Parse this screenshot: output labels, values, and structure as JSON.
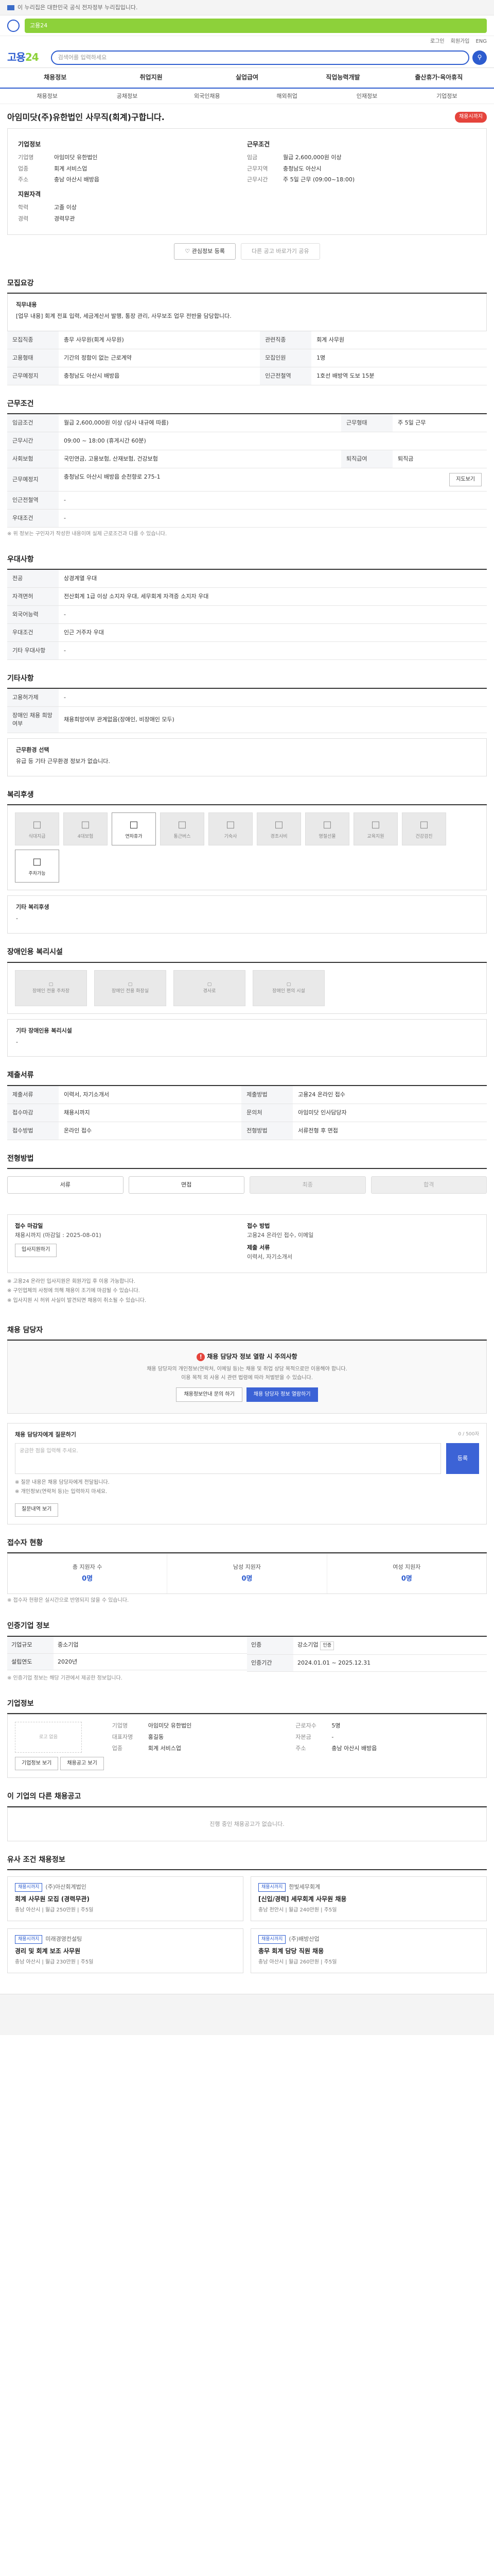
{
  "noticebar": {
    "text": "이 누리집은 대한민국 공식 전자정부 누리집입니다."
  },
  "topbar": {
    "search_text": "고용24"
  },
  "topright": {
    "links": [
      "로그인",
      "회원가입",
      "ENG"
    ]
  },
  "header": {
    "brand_a": "고용",
    "brand_b": "24",
    "search_placeholder": "검색어를 입력하세요"
  },
  "gnb": [
    "채용정보",
    "취업지원",
    "실업급여",
    "직업능력개발",
    "출산휴가·육아휴직"
  ],
  "subnav": [
    "채용정보",
    "공채정보",
    "외국인채용",
    "해외취업",
    "인재정보",
    "기업정보"
  ],
  "job": {
    "title": "아임미닷(주)유한법인 사무직(회계)구합니다.",
    "badge": "채용시까지",
    "corp_h": "기업정보",
    "corp_name_k": "기업명",
    "corp_name_v": "아임미닷 유한법인",
    "corp_field_k": "업종",
    "corp_field_v": "회계 서비스업",
    "corp_addr_k": "주소",
    "corp_addr_v": "충남 아산시 배방읍",
    "cond_h": "근무조건",
    "cond_wage_k": "임금",
    "cond_wage_v": "월급 2,600,000원 이상",
    "cond_area_k": "근무지역",
    "cond_area_v": "충청남도 아산시",
    "cond_time_k": "근무시간",
    "cond_time_v": "주 5일 근무 (09:00~18:00)",
    "req_h": "지원자격",
    "req_edu_k": "학력",
    "req_edu_v": "고졸 이상",
    "req_exp_k": "경력",
    "req_exp_v": "경력무관"
  },
  "actions": {
    "scrap": "관심정보 등록",
    "share": "다른 공고 바로가기 공유"
  },
  "sections": {
    "recruit": "모집요강",
    "work": "근무조건",
    "welfare": "복리후생",
    "welfare_facility": "장애인용 복리시설",
    "extra": "우대사항",
    "etc": "기타사항",
    "benefit": "복리후생",
    "doc": "제출서류",
    "method": "전형방법",
    "apply": "접수방법",
    "manager": "채용 담당자",
    "stats": "접수자 현황",
    "info": "인증기업 정보",
    "company": "기업정보",
    "others": "이 기업의 다른 채용공고",
    "similar": "유사 조건 채용정보"
  },
  "recruit": {
    "desc_h": "직무내용",
    "desc": "[업무 내용] 회계 전표 입력, 세금계산서 발행, 통장 관리, 사무보조 업무 전반을 담당합니다.",
    "rows": [
      {
        "k": "모집직종",
        "v": "총무 사무원(회계 사무원)"
      },
      {
        "k": "관련직종",
        "v": "회계 사무원"
      },
      {
        "k": "고용형태",
        "v": "기간의 정함이 없는 근로계약"
      },
      {
        "k": "모집인원",
        "v": "1명"
      },
      {
        "k": "근무예정지",
        "v": "충청남도 아산시 배방읍"
      },
      {
        "k": "인근전철역",
        "v": "1호선 배방역 도보 15분"
      }
    ]
  },
  "work": {
    "rows": [
      {
        "k": "임금조건",
        "v": "월급 2,600,000원 이상 (당사 내규에 따름)"
      },
      {
        "k": "근무형태",
        "v": "주 5일 근무"
      },
      {
        "k": "근무시간",
        "v": "09:00 ~ 18:00 (휴게시간 60분)"
      },
      {
        "k": "사회보험",
        "v": "국민연금, 고용보험, 산재보험, 건강보험"
      },
      {
        "k": "퇴직급여",
        "v": "퇴직금"
      },
      {
        "k": "근무예정지",
        "v": "충청남도 아산시 배방읍 순천향로 275-1"
      },
      {
        "k": "인근전철역",
        "v": "-"
      },
      {
        "k": "우대조건",
        "v": "-"
      }
    ],
    "note": "※ 위 정보는 구인자가 작성한 내용이며 실제 근로조건과 다를 수 있습니다."
  },
  "extra": {
    "rows": [
      {
        "k": "전공",
        "v": "상경계열 우대"
      },
      {
        "k": "자격면허",
        "v": "전산회계 1급 이상 소지자 우대, 세무회계 자격증 소지자 우대"
      },
      {
        "k": "외국어능력",
        "v": "-"
      },
      {
        "k": "우대조건",
        "v": "인근 거주자 우대"
      },
      {
        "k": "기타 우대사항",
        "v": "-"
      }
    ]
  },
  "etc": {
    "rows": [
      {
        "k": "고용허가제",
        "v": "-"
      },
      {
        "k": "장애인 채용 희망여부",
        "v": "채용희망여부 관계없음(장애인, 비장애인 모두)"
      }
    ],
    "subh": "근무환경 선택",
    "subv": "유급 등 기타 근무환경 정보가 없습니다."
  },
  "welfare": {
    "icons": [
      "식대지급",
      "4대보험",
      "연차휴가",
      "통근버스",
      "기숙사",
      "경조사비",
      "명절선물",
      "교육지원",
      "건강검진",
      "주차가능"
    ],
    "on": [
      2,
      9
    ],
    "etc_h": "기타 복리후생",
    "etc_v": "-"
  },
  "facility": {
    "icons": [
      "장애인 전용 주차장",
      "장애인 전용 화장실",
      "경사로",
      "장애인 편의 시설"
    ],
    "etc_h": "기타 장애인용 복리시설",
    "etc_v": "-"
  },
  "doc": {
    "rows": [
      {
        "k": "제출서류",
        "v": "이력서, 자기소개서"
      },
      {
        "k": "제출방법",
        "v": "고용24 온라인 접수"
      },
      {
        "k": "접수마감",
        "v": "채용시까지"
      },
      {
        "k": "문의처",
        "v": "아임미닷 인사담당자"
      },
      {
        "k": "접수방법",
        "v": "온라인 접수"
      },
      {
        "k": "전형방법",
        "v": "서류전형 후 면접"
      }
    ]
  },
  "method": {
    "steps": [
      "서류",
      "면접",
      "최종",
      "합격"
    ],
    "off": [
      2,
      3
    ]
  },
  "apply": {
    "l1": "접수 마감일",
    "v1": "채용시까지 (마감일 : 2025-08-01)",
    "l2": "접수 방법",
    "v2": "고용24 온라인 접수, 이메일",
    "l3": "제출 서류",
    "v3": "이력서, 자기소개서",
    "btn": "입사지원하기",
    "bul": [
      "※ 고용24 온라인 입사지원은 회원가입 후 이용 가능합니다.",
      "※ 구인업체의 사정에 의해 채용이 조기에 마감될 수 있습니다.",
      "※ 입사지원 시 허위 사실이 발견되면 채용이 취소될 수 있습니다."
    ]
  },
  "manager": {
    "warn": "채용 담당자 정보 열람 시 주의사항",
    "d1": "채용 담당자의 개인정보(연락처, 이메일 등)는 채용 및 취업 상담 목적으로만 이용해야 합니다.",
    "d2": "이용 목적 외 사용 시 관련 법령에 따라 처벌받을 수 있습니다.",
    "b1": "채용정보안내 문의 하기",
    "b2": "채용 담당자 정보 열람하기"
  },
  "qa": {
    "h": "채용 담당자에게 질문하기",
    "count": "0 / 500자",
    "placeholder": "궁금한 점을 입력해 주세요.",
    "go": "등록",
    "bul": [
      "※ 질문 내용은 채용 담당자에게 전달됩니다.",
      "※ 개인정보(연락처 등)는 입력하지 마세요."
    ],
    "more": "질문내역 보기"
  },
  "stats": [
    {
      "l": "총 지원자 수",
      "v": "0명"
    },
    {
      "l": "남성 지원자",
      "v": "0명"
    },
    {
      "l": "여성 지원자",
      "v": "0명"
    }
  ],
  "stats_note": "※ 접수자 현황은 실시간으로 반영되지 않을 수 있습니다.",
  "info": {
    "left": [
      {
        "k": "기업규모",
        "v": "중소기업"
      },
      {
        "k": "설립연도",
        "v": "2020년"
      }
    ],
    "right": [
      {
        "k": "인증",
        "v": "강소기업",
        "tag": "인증"
      },
      {
        "k": "인증기간",
        "v": "2024.01.01 ~ 2025.12.31"
      }
    ],
    "note": "※ 인증기업 정보는 해당 기관에서 제공한 정보입니다."
  },
  "company": {
    "logo": "로고 없음",
    "c1": [
      {
        "k": "기업명",
        "v": "아임미닷 유한법인"
      },
      {
        "k": "대표자명",
        "v": "홍길동"
      },
      {
        "k": "업종",
        "v": "회계 서비스업"
      }
    ],
    "c2": [
      {
        "k": "근로자수",
        "v": "5명"
      },
      {
        "k": "자본금",
        "v": "-"
      },
      {
        "k": "주소",
        "v": "충남 아산시 배방읍"
      }
    ],
    "btn1": "기업정보 보기",
    "btn2": "채용공고 보기"
  },
  "others_empty": "진행 중인 채용공고가 없습니다.",
  "similar": [
    {
      "badge": "채용시까지",
      "corp": "(주)아산회계법인",
      "title": "회계 사무원 모집 (경력무관)",
      "meta": "충남 아산시 | 월급 250만원 | 주5일"
    },
    {
      "badge": "채용시까지",
      "corp": "한빛세무회계",
      "title": "[신입/경력] 세무회계 사무원 채용",
      "meta": "충남 천안시 | 월급 240만원 | 주5일"
    },
    {
      "badge": "채용시까지",
      "corp": "미래경영컨설팅",
      "title": "경리 및 회계 보조 사무원",
      "meta": "충남 아산시 | 월급 230만원 | 주5일"
    },
    {
      "badge": "채용시까지",
      "corp": "(주)배방산업",
      "title": "총무 회계 담당 직원 채용",
      "meta": "충남 아산시 | 월급 260만원 | 주5일"
    }
  ],
  "colors": {
    "brand": "#2d5ccf",
    "accent": "#8dd13a",
    "alert": "#e5443c"
  }
}
